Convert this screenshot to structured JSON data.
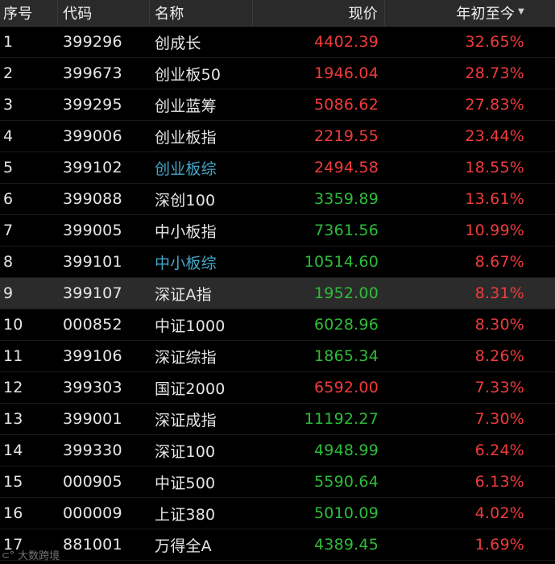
{
  "header": {
    "idx": "序号",
    "code": "代码",
    "name": "名称",
    "price": "现价",
    "ytd": "年初至今",
    "sort_icon": "sort-down-icon"
  },
  "colors": {
    "up": "#f03b3b",
    "down": "#2dbd3a",
    "link": "#41a8c8",
    "background": "#000000",
    "header_bg": "#2a2a2a"
  },
  "rows": [
    {
      "idx": "1",
      "code": "399296",
      "name": "创成长",
      "price": "4402.39",
      "ytd": "32.65%",
      "price_dir": "up",
      "name_style": "normal"
    },
    {
      "idx": "2",
      "code": "399673",
      "name": "创业板50",
      "price": "1946.04",
      "ytd": "28.73%",
      "price_dir": "up",
      "name_style": "normal"
    },
    {
      "idx": "3",
      "code": "399295",
      "name": "创业蓝筹",
      "price": "5086.62",
      "ytd": "27.83%",
      "price_dir": "up",
      "name_style": "normal"
    },
    {
      "idx": "4",
      "code": "399006",
      "name": "创业板指",
      "price": "2219.55",
      "ytd": "23.44%",
      "price_dir": "up",
      "name_style": "normal"
    },
    {
      "idx": "5",
      "code": "399102",
      "name": "创业板综",
      "price": "2494.58",
      "ytd": "18.55%",
      "price_dir": "up",
      "name_style": "link"
    },
    {
      "idx": "6",
      "code": "399088",
      "name": "深创100",
      "price": "3359.89",
      "ytd": "13.61%",
      "price_dir": "down",
      "name_style": "normal"
    },
    {
      "idx": "7",
      "code": "399005",
      "name": "中小板指",
      "price": "7361.56",
      "ytd": "10.99%",
      "price_dir": "down",
      "name_style": "normal"
    },
    {
      "idx": "8",
      "code": "399101",
      "name": "中小板综",
      "price": "10514.60",
      "ytd": "8.67%",
      "price_dir": "down",
      "name_style": "link"
    },
    {
      "idx": "9",
      "code": "399107",
      "name": "深证A指",
      "price": "1952.00",
      "ytd": "8.31%",
      "price_dir": "down",
      "name_style": "normal"
    },
    {
      "idx": "10",
      "code": "000852",
      "name": "中证1000",
      "price": "6028.96",
      "ytd": "8.30%",
      "price_dir": "down",
      "name_style": "normal"
    },
    {
      "idx": "11",
      "code": "399106",
      "name": "深证综指",
      "price": "1865.34",
      "ytd": "8.26%",
      "price_dir": "down",
      "name_style": "normal"
    },
    {
      "idx": "12",
      "code": "399303",
      "name": "国证2000",
      "price": "6592.00",
      "ytd": "7.33%",
      "price_dir": "up",
      "name_style": "normal"
    },
    {
      "idx": "13",
      "code": "399001",
      "name": "深证成指",
      "price": "11192.27",
      "ytd": "7.30%",
      "price_dir": "down",
      "name_style": "normal"
    },
    {
      "idx": "14",
      "code": "399330",
      "name": "深证100",
      "price": "4948.99",
      "ytd": "6.24%",
      "price_dir": "down",
      "name_style": "normal"
    },
    {
      "idx": "15",
      "code": "000905",
      "name": "中证500",
      "price": "5590.64",
      "ytd": "6.13%",
      "price_dir": "down",
      "name_style": "normal"
    },
    {
      "idx": "16",
      "code": "000009",
      "name": "上证380",
      "price": "5010.09",
      "ytd": "4.02%",
      "price_dir": "down",
      "name_style": "normal"
    },
    {
      "idx": "17",
      "code": "881001",
      "name": "万得全A",
      "price": "4389.45",
      "ytd": "1.69%",
      "price_dir": "down",
      "name_style": "normal"
    }
  ],
  "selected_row": "9",
  "watermark": "大数跨境"
}
